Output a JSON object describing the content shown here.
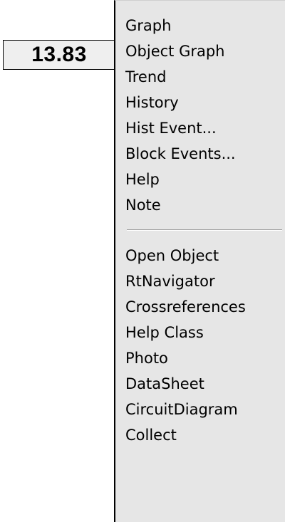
{
  "value_field": {
    "value": "13.83"
  },
  "menu": {
    "group1": [
      {
        "label": "Graph"
      },
      {
        "label": "Object Graph"
      },
      {
        "label": "Trend"
      },
      {
        "label": "History"
      },
      {
        "label": "Hist Event..."
      },
      {
        "label": "Block Events..."
      },
      {
        "label": "Help"
      },
      {
        "label": "Note"
      }
    ],
    "group2": [
      {
        "label": "Open Object"
      },
      {
        "label": "RtNavigator"
      },
      {
        "label": "Crossreferences"
      },
      {
        "label": "Help Class"
      },
      {
        "label": "Photo"
      },
      {
        "label": "DataSheet"
      },
      {
        "label": "CircuitDiagram"
      },
      {
        "label": "Collect"
      }
    ]
  },
  "colors": {
    "menu_background": "#e6e6e6",
    "field_background": "#efefef",
    "text": "#000000"
  }
}
